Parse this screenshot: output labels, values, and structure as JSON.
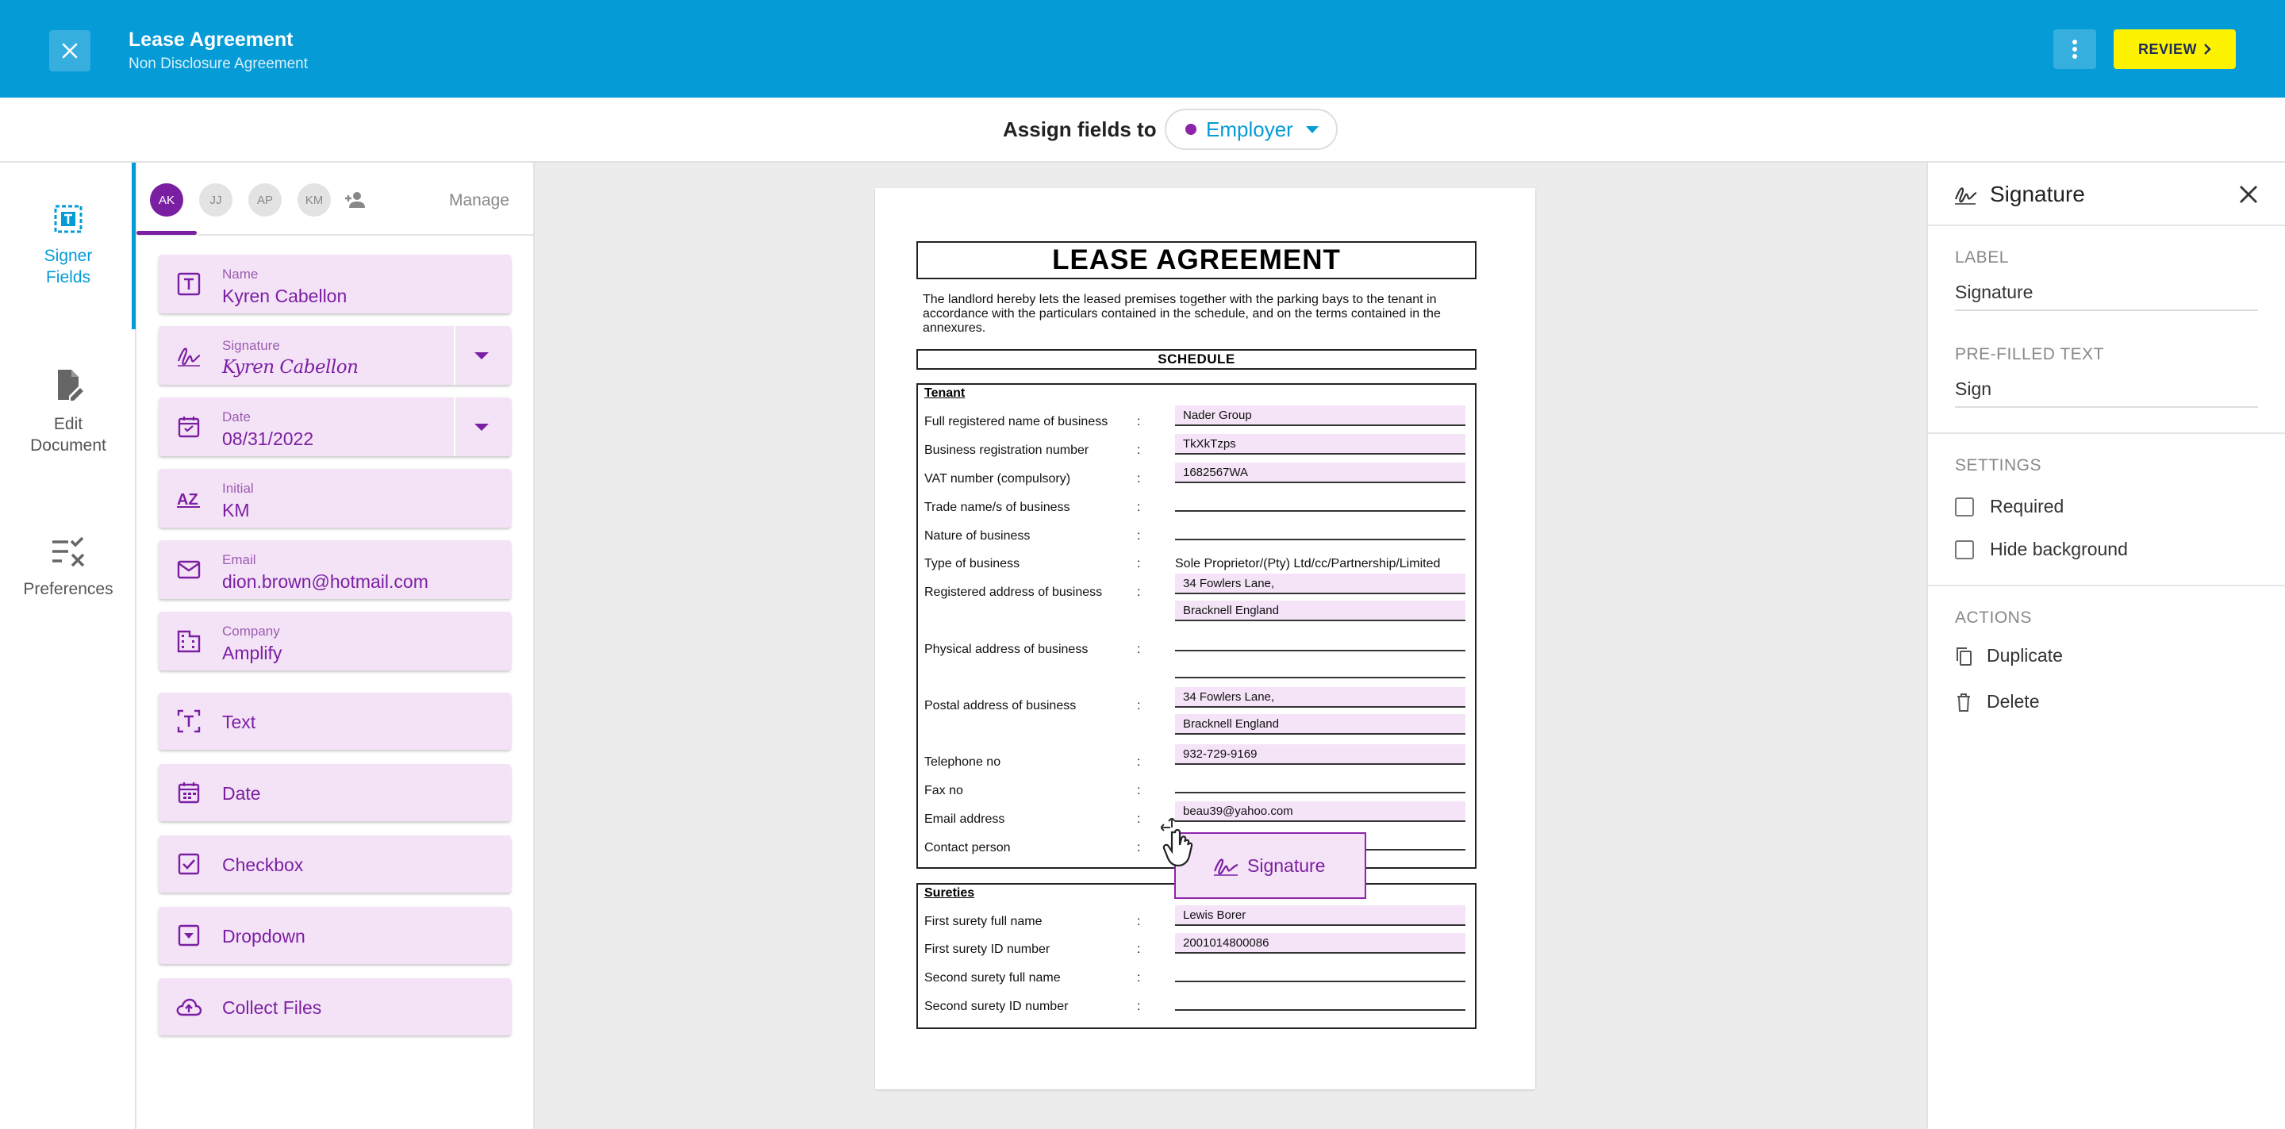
{
  "header": {
    "title": "Lease Agreement",
    "subtitle": "Non Disclosure Agreement",
    "review_label": "REVIEW"
  },
  "assign": {
    "label": "Assign fields to",
    "selected_role": "Employer",
    "role_color": "#8e24aa"
  },
  "leftnav": {
    "items": [
      {
        "label_line1": "Signer",
        "label_line2": "Fields",
        "icon": "text-box-icon",
        "active": true
      },
      {
        "label_line1": "Edit",
        "label_line2": "Document",
        "icon": "document-edit-icon",
        "active": false
      },
      {
        "label_line1": "Preferences",
        "label_line2": "",
        "icon": "checklist-icon",
        "active": false
      }
    ]
  },
  "signers": {
    "avatars": [
      "AK",
      "JJ",
      "AP",
      "KM"
    ],
    "manage_label": "Manage"
  },
  "fields": {
    "name": {
      "label": "Name",
      "value": "Kyren Cabellon"
    },
    "signature": {
      "label": "Signature",
      "value": "Kyren Cabellon"
    },
    "date": {
      "label": "Date",
      "value": "08/31/2022"
    },
    "initial": {
      "label": "Initial",
      "value": "KM"
    },
    "email": {
      "label": "Email",
      "value": "dion.brown@hotmail.com"
    },
    "company": {
      "label": "Company",
      "value": "Amplify"
    },
    "generic": [
      "Text",
      "Date",
      "Checkbox",
      "Dropdown",
      "Collect Files"
    ]
  },
  "document": {
    "title": "LEASE AGREEMENT",
    "intro": "The landlord hereby lets the leased premises together with the parking bays to the tenant in accordance with the particulars contained in the schedule, and on the terms contained in the annexures.",
    "schedule_label": "SCHEDULE",
    "tenant_heading": "Tenant",
    "colon": ":",
    "tenant_rows": {
      "full_name": {
        "label": "Full registered name of business",
        "value": "Nader Group"
      },
      "reg_number": {
        "label": "Business registration number",
        "value": "TkXkTzps"
      },
      "vat": {
        "label": "VAT number (compulsory)",
        "value": "1682567WA"
      },
      "trade_name": {
        "label": "Trade name/s of business",
        "value": ""
      },
      "nature": {
        "label": "Nature of business",
        "value": ""
      },
      "type": {
        "label": "Type of business",
        "value": "Sole Proprietor/(Pty) Ltd/cc/Partnership/Limited"
      },
      "reg_address": {
        "label": "Registered address of business",
        "value1": "34 Fowlers Lane,",
        "value2": "Bracknell England"
      },
      "phys_address": {
        "label": "Physical address of business",
        "value": ""
      },
      "postal_address": {
        "label": "Postal address of business",
        "value1": "34 Fowlers Lane,",
        "value2": "Bracknell England"
      },
      "telephone": {
        "label": "Telephone no",
        "value": "932-729-9169"
      },
      "fax": {
        "label": "Fax no",
        "value": ""
      },
      "email": {
        "label": "Email address",
        "value": "beau39@yahoo.com"
      },
      "contact": {
        "label": "Contact person",
        "value": ""
      }
    },
    "sureties_heading": "Sureties",
    "surety_rows": {
      "first_name": {
        "label": "First surety full name",
        "value": "Lewis Borer"
      },
      "first_id": {
        "label": "First surety ID number",
        "value": "2001014800086"
      },
      "second_name": {
        "label": "Second surety full name",
        "value": ""
      },
      "second_id": {
        "label": "Second surety ID number",
        "value": ""
      }
    },
    "drag_field_label": "Signature"
  },
  "properties": {
    "title": "Signature",
    "label_heading": "LABEL",
    "label_value": "Signature",
    "prefilled_heading": "PRE-FILLED TEXT",
    "prefilled_value": "Sign",
    "settings_heading": "SETTINGS",
    "required_label": "Required",
    "hide_bg_label": "Hide background",
    "actions_heading": "ACTIONS",
    "duplicate_label": "Duplicate",
    "delete_label": "Delete"
  },
  "colors": {
    "brand_blue": "#049bd7",
    "review_yellow": "#fdf300",
    "field_purple": "#7b1fa2",
    "field_bg": "#f4e3f7"
  }
}
